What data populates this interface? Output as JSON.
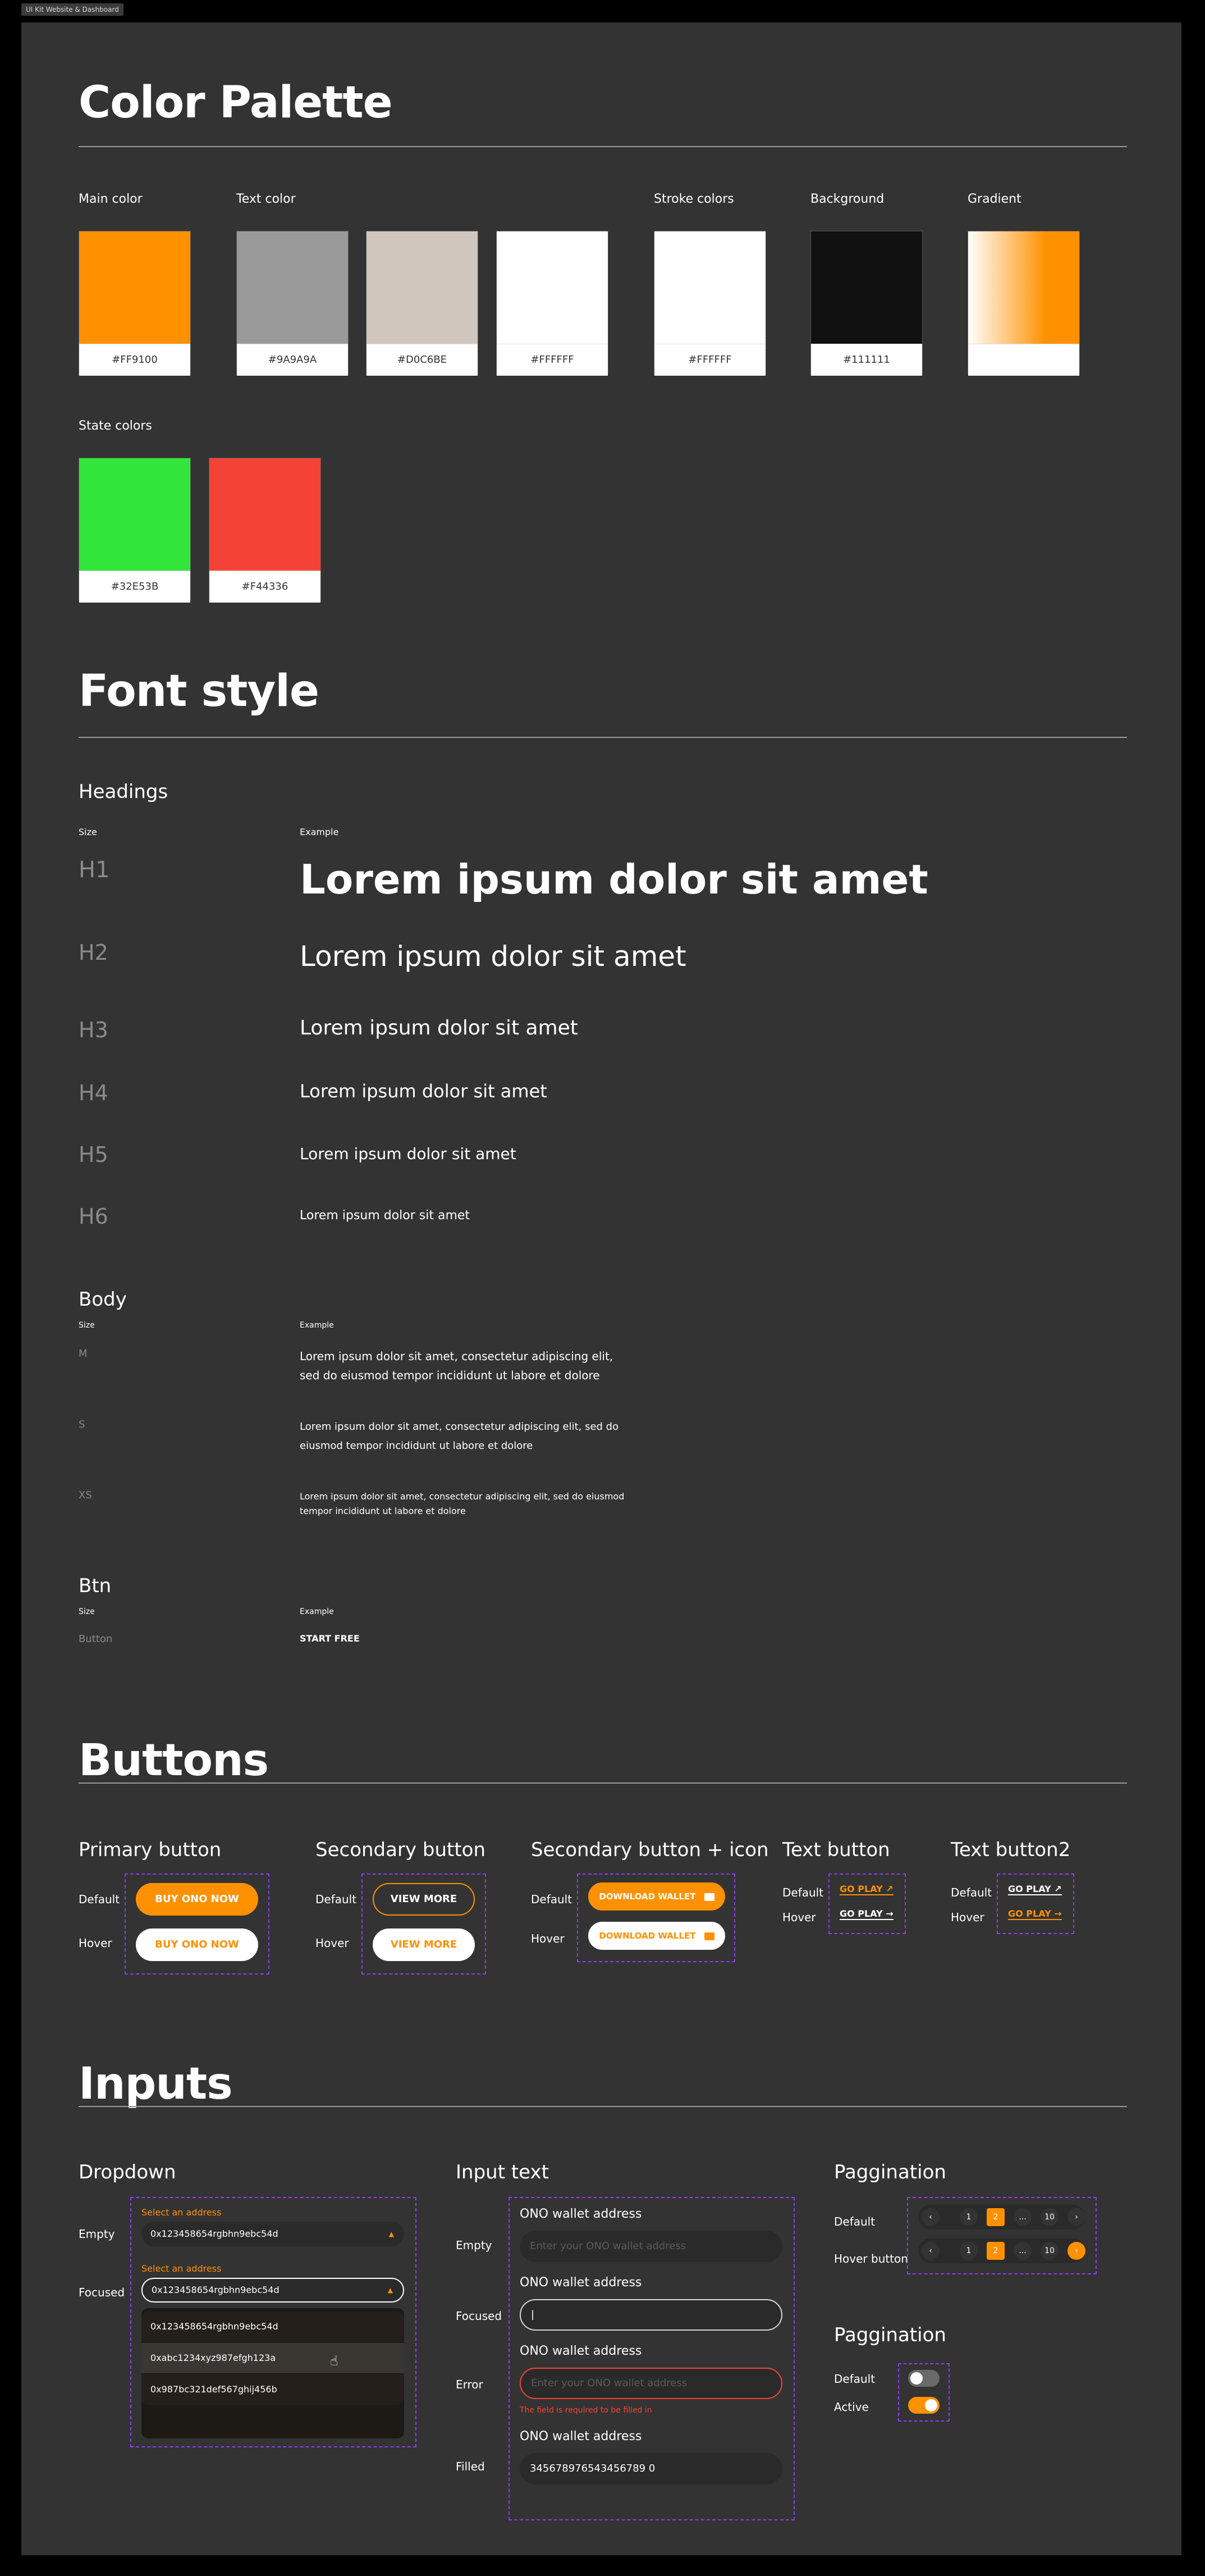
{
  "window_tag": "UI Kit Website & Dashboard",
  "palette": {
    "title": "Color Palette",
    "main_label": "Main color",
    "text_label": "Text color",
    "stroke_label": "Stroke colors",
    "background_label": "Background",
    "gradient_label": "Gradient",
    "state_label": "State colors",
    "swatches": {
      "main": "#FF9100",
      "text1": "#9A9A9A",
      "text2": "#D0C6BE",
      "text3": "#FFFFFF",
      "stroke": "#FFFFFF",
      "background": "#111111",
      "success": "#32E53B",
      "error": "#F44336"
    }
  },
  "fonts": {
    "title": "Font style",
    "headings_label": "Headings",
    "size_label": "Size",
    "example_label": "Example",
    "h1": "H1",
    "h2": "H2",
    "h3": "H3",
    "h4": "H4",
    "h5": "H5",
    "h6": "H6",
    "heading_example": "Lorem ipsum dolor sit amet",
    "body_label": "Body",
    "m": "M",
    "s": "S",
    "xs": "XS",
    "body_example": "Lorem ipsum dolor sit amet, consectetur adipiscing elit, sed do eiusmod tempor incididunt ut labore et dolore",
    "btn_label": "Btn",
    "button_size": "Button",
    "button_example": "START FREE"
  },
  "buttons": {
    "title": "Buttons",
    "primary_title": "Primary button",
    "secondary_title": "Secondary button",
    "secondary_icon_title": "Secondary button + icon",
    "text_title": "Text button",
    "text2_title": "Text button2",
    "default": "Default",
    "hover": "Hover",
    "buy": "BUY ONO NOW",
    "view_more": "VIEW MORE",
    "download": "DOWNLOAD WALLET",
    "go_play": "GO PLAY"
  },
  "inputs": {
    "title": "Inputs",
    "dropdown_title": "Dropdown",
    "empty": "Empty",
    "focused": "Focused",
    "select_label": "Select an address",
    "selected_value": "0x123458654rgbhn9ebc54d",
    "options": [
      "0x123458654rgbhn9ebc54d",
      "0xabc1234xyz987efgh123a",
      "0x987bc321def567ghij456b"
    ],
    "text_title": "Input text",
    "error": "Error",
    "filled": "Filled",
    "field_label": "ONO wallet address",
    "placeholder": "Enter your ONO wallet address",
    "focused_value": "|",
    "error_msg": "The field is required to be filled in",
    "filled_value": "345678976543456789 0",
    "pagination_title": "Paggination",
    "pagination_title2": "Paggination",
    "hover_button": "Hover button",
    "active": "Active",
    "pages": [
      "1",
      "2",
      "...",
      "10"
    ],
    "prev": "‹",
    "next": "›"
  }
}
